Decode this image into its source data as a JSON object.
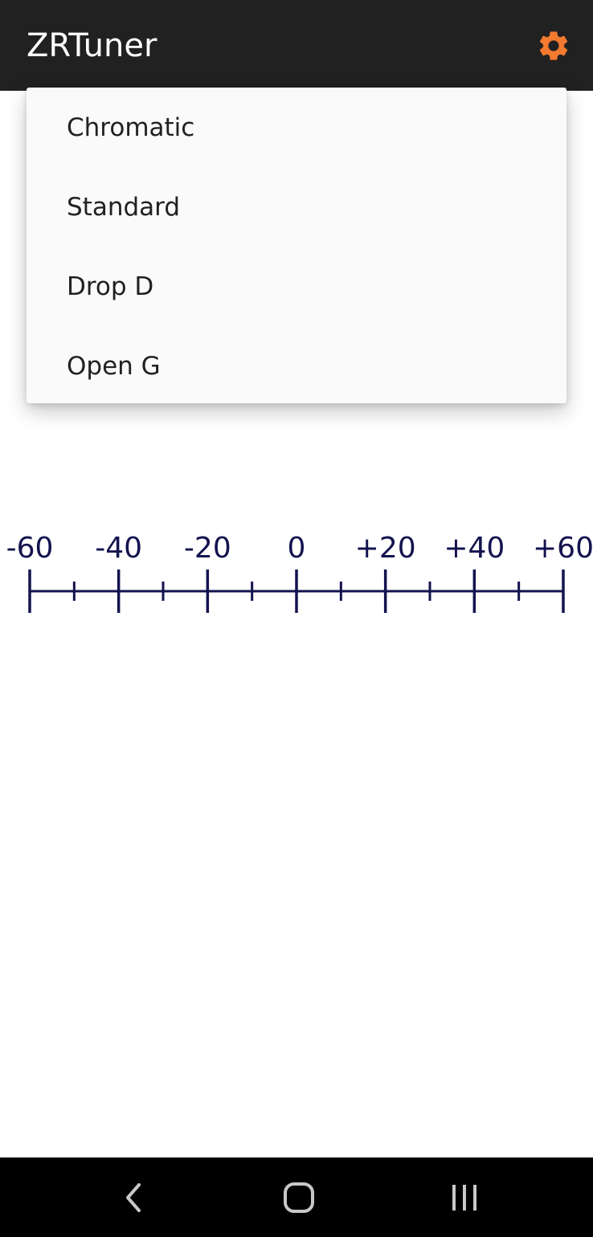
{
  "app": {
    "title": "ZRTuner",
    "accent_color": "#f47a30",
    "appbar_color": "#212121"
  },
  "toolbar": {
    "settings_icon": "gear-icon"
  },
  "tuning_menu": {
    "items": [
      {
        "label": "Chromatic"
      },
      {
        "label": "Standard"
      },
      {
        "label": "Drop D"
      },
      {
        "label": "Open G"
      }
    ]
  },
  "cents_scale": {
    "color": "#13134f",
    "labels": [
      "-60",
      "-40",
      "-20",
      "0",
      "+20",
      "+40",
      "+60"
    ]
  },
  "system_nav": {
    "back_icon": "back-chevron-icon",
    "home_icon": "home-icon",
    "recents_icon": "recents-icon"
  }
}
